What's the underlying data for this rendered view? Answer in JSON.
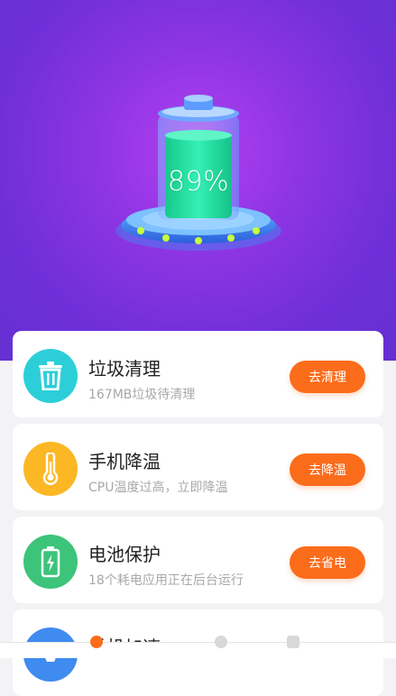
{
  "hero": {
    "battery_level": "89%"
  },
  "cards": [
    {
      "title": "垃圾清理",
      "subtitle": "167MB垃圾待清理",
      "button": "去清理",
      "icon": "trash-icon",
      "icon_color": "#2ccfd8"
    },
    {
      "title": "手机降温",
      "subtitle": "CPU温度过高，立即降温",
      "button": "去降温",
      "icon": "thermometer-icon",
      "icon_color": "#fbb724"
    },
    {
      "title": "电池保护",
      "subtitle": "18个耗电应用正在后台运行",
      "button": "去省电",
      "icon": "battery-icon",
      "icon_color": "#3cc47a"
    },
    {
      "title": "手机加速",
      "subtitle": "",
      "button": "",
      "icon": "rocket-icon",
      "icon_color": "#3f8bf0"
    }
  ],
  "colors": {
    "hero_purple": "#8e35e3",
    "button_orange": "#fb6c1b",
    "battery_green": "#22e2a1"
  }
}
